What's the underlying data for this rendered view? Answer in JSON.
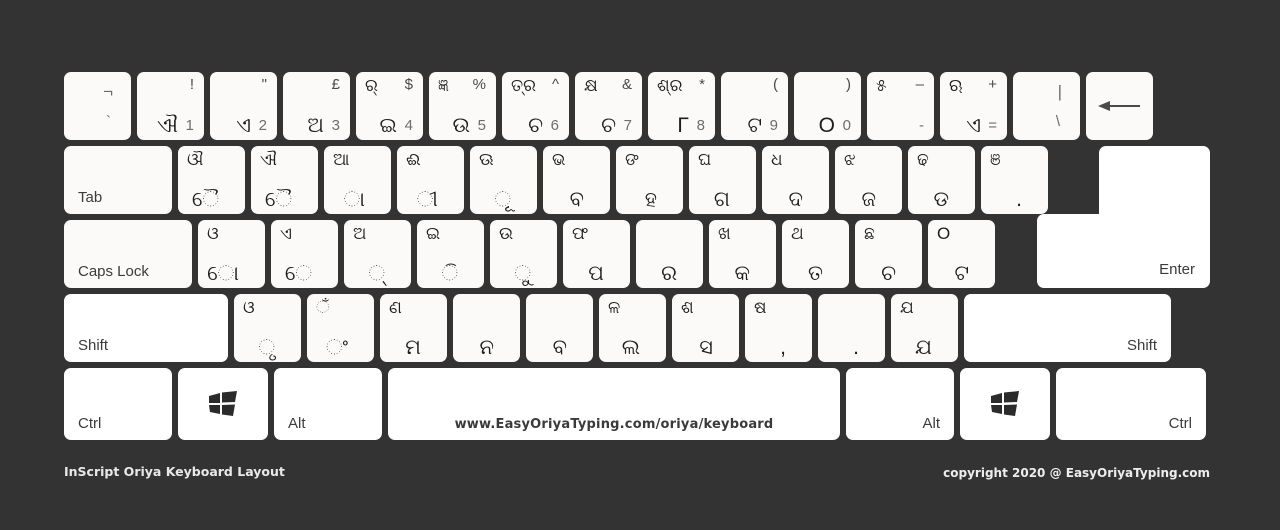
{
  "meta": {
    "title": "InScript Oriya Keyboard Layout",
    "copyright": "copyright 2020 @ EasyOriyaTyping.com",
    "spacebar_url": "www.EasyOriyaTyping.com/oriya/keyboard",
    "background_color": "#333333",
    "key_color": "#fbfaf8",
    "key_color_modifier": "#ffffff"
  },
  "rows": {
    "row1": [
      {
        "name": "backtick",
        "top_right": "¬",
        "bottom_right": "`"
      },
      {
        "name": "digit-1",
        "top_left": "",
        "top_right": "!",
        "bottom_left": "ଐ",
        "bottom_right": "1"
      },
      {
        "name": "digit-2",
        "top_right": "\"",
        "bottom_left": "ଏ",
        "bottom_right": "2"
      },
      {
        "name": "digit-3",
        "top_right": "£",
        "bottom_left": "ଅ",
        "bottom_right": "3"
      },
      {
        "name": "digit-4",
        "top_left": "ର୍",
        "top_right": "$",
        "bottom_left": "ଇ",
        "bottom_right": "4"
      },
      {
        "name": "digit-5",
        "top_left": "ଜ୍ଞ",
        "top_right": "%",
        "bottom_left": "ଉ",
        "bottom_right": "5"
      },
      {
        "name": "digit-6",
        "top_left": "ତ୍ର",
        "top_right": "^",
        "bottom_left": "ଚ",
        "bottom_right": "6"
      },
      {
        "name": "digit-7",
        "top_left": "କ୍ଷ",
        "top_right": "&",
        "bottom_left": "ଚ",
        "bottom_right": "7"
      },
      {
        "name": "digit-8",
        "top_left": "ଶ୍ର",
        "top_right": "*",
        "bottom_left": "Γ",
        "bottom_right": "8"
      },
      {
        "name": "digit-9",
        "top_right": "(",
        "bottom_left": "ଟ",
        "bottom_right": "9"
      },
      {
        "name": "digit-0",
        "top_right": ")",
        "bottom_left": "O",
        "bottom_right": "0"
      },
      {
        "name": "minus",
        "top_left": "୫",
        "top_right": "–",
        "bottom_right": "-"
      },
      {
        "name": "equals",
        "top_left": "ଋ",
        "top_right": "+",
        "bottom_left": "ଏ",
        "bottom_right": "="
      },
      {
        "name": "backslash",
        "top_right": "|",
        "bottom_right": "\\"
      },
      {
        "name": "backspace",
        "icon": "backspace-arrow-icon"
      }
    ],
    "row2": [
      {
        "name": "tab",
        "label": "Tab"
      },
      {
        "name": "key-q",
        "top_left": "ଔ",
        "bottom_left": "ୈ"
      },
      {
        "name": "key-w",
        "top_left": "ଐ",
        "bottom_left": "ୈ"
      },
      {
        "name": "key-e",
        "top_left": "ଆ",
        "bottom_left": "ା"
      },
      {
        "name": "key-r",
        "top_left": "ଈ",
        "bottom_left": "ୀ"
      },
      {
        "name": "key-t",
        "top_left": "ଊ",
        "bottom_left": "ୂ"
      },
      {
        "name": "key-y",
        "top_left": "ଭ",
        "bottom_left": "ବ"
      },
      {
        "name": "key-u",
        "top_left": "ଙ",
        "bottom_left": "ହ"
      },
      {
        "name": "key-i",
        "top_left": "ଘ",
        "bottom_left": "ଗ"
      },
      {
        "name": "key-o",
        "top_left": "ଧ",
        "bottom_left": "ଦ"
      },
      {
        "name": "key-p",
        "top_left": "ଝ",
        "bottom_left": "ଜ"
      },
      {
        "name": "key-bracket-left",
        "top_left": "ଢ",
        "bottom_left": "ଡ"
      },
      {
        "name": "key-bracket-right",
        "top_left": "ଞ",
        "bottom_left": "."
      }
    ],
    "row3": [
      {
        "name": "caps-lock",
        "label": "Caps Lock"
      },
      {
        "name": "key-a",
        "top_left": "ଓ",
        "bottom_left": "ୋ"
      },
      {
        "name": "key-s",
        "top_left": "ଏ",
        "bottom_left": "େ"
      },
      {
        "name": "key-d",
        "top_left": "ଅ",
        "bottom_left": "୍"
      },
      {
        "name": "key-f",
        "top_left": "ଇ",
        "bottom_left": "ି"
      },
      {
        "name": "key-g",
        "top_left": "ଉ",
        "bottom_left": "ୁ"
      },
      {
        "name": "key-h",
        "top_left": "ଫ",
        "bottom_left": "ପ"
      },
      {
        "name": "key-j",
        "top_left": "",
        "bottom_left": "ର"
      },
      {
        "name": "key-k",
        "top_left": "ଖ",
        "bottom_left": "କ"
      },
      {
        "name": "key-l",
        "top_left": "ଥ",
        "bottom_left": "ତ"
      },
      {
        "name": "key-semicolon",
        "top_left": "ଛ",
        "bottom_left": "ଚ"
      },
      {
        "name": "key-quote",
        "top_left": "O",
        "bottom_left": "ଟ"
      },
      {
        "name": "enter",
        "label": "Enter"
      }
    ],
    "row4": [
      {
        "name": "left-shift",
        "label": "Shift"
      },
      {
        "name": "key-z",
        "top_left": "ଓ",
        "bottom_left": "ୃ"
      },
      {
        "name": "key-x",
        "top_left": "ଁ",
        "bottom_left": "ଂ"
      },
      {
        "name": "key-c",
        "top_left": "ଣ",
        "bottom_left": "ମ"
      },
      {
        "name": "key-v",
        "top_left": "",
        "bottom_left": "ନ"
      },
      {
        "name": "key-b",
        "top_left": "",
        "bottom_left": "ବ"
      },
      {
        "name": "key-n",
        "top_left": "ଳ",
        "bottom_left": "ଲ"
      },
      {
        "name": "key-m",
        "top_left": "ଶ",
        "bottom_left": "ସ"
      },
      {
        "name": "key-comma",
        "top_left": "ଷ",
        "bottom_left": ","
      },
      {
        "name": "key-period",
        "top_left": "",
        "bottom_left": "."
      },
      {
        "name": "key-slash",
        "top_left": "ଯ",
        "bottom_left": "ଯ"
      },
      {
        "name": "right-shift",
        "label": "Shift"
      }
    ],
    "row5": [
      {
        "name": "left-ctrl",
        "label": "Ctrl"
      },
      {
        "name": "left-win",
        "icon": "windows-logo-icon"
      },
      {
        "name": "left-alt",
        "label": "Alt"
      },
      {
        "name": "spacebar",
        "label": "www.EasyOriyaTyping.com/oriya/keyboard"
      },
      {
        "name": "right-alt",
        "label": "Alt"
      },
      {
        "name": "right-win",
        "icon": "windows-logo-icon"
      },
      {
        "name": "right-ctrl",
        "label": "Ctrl"
      }
    ]
  }
}
